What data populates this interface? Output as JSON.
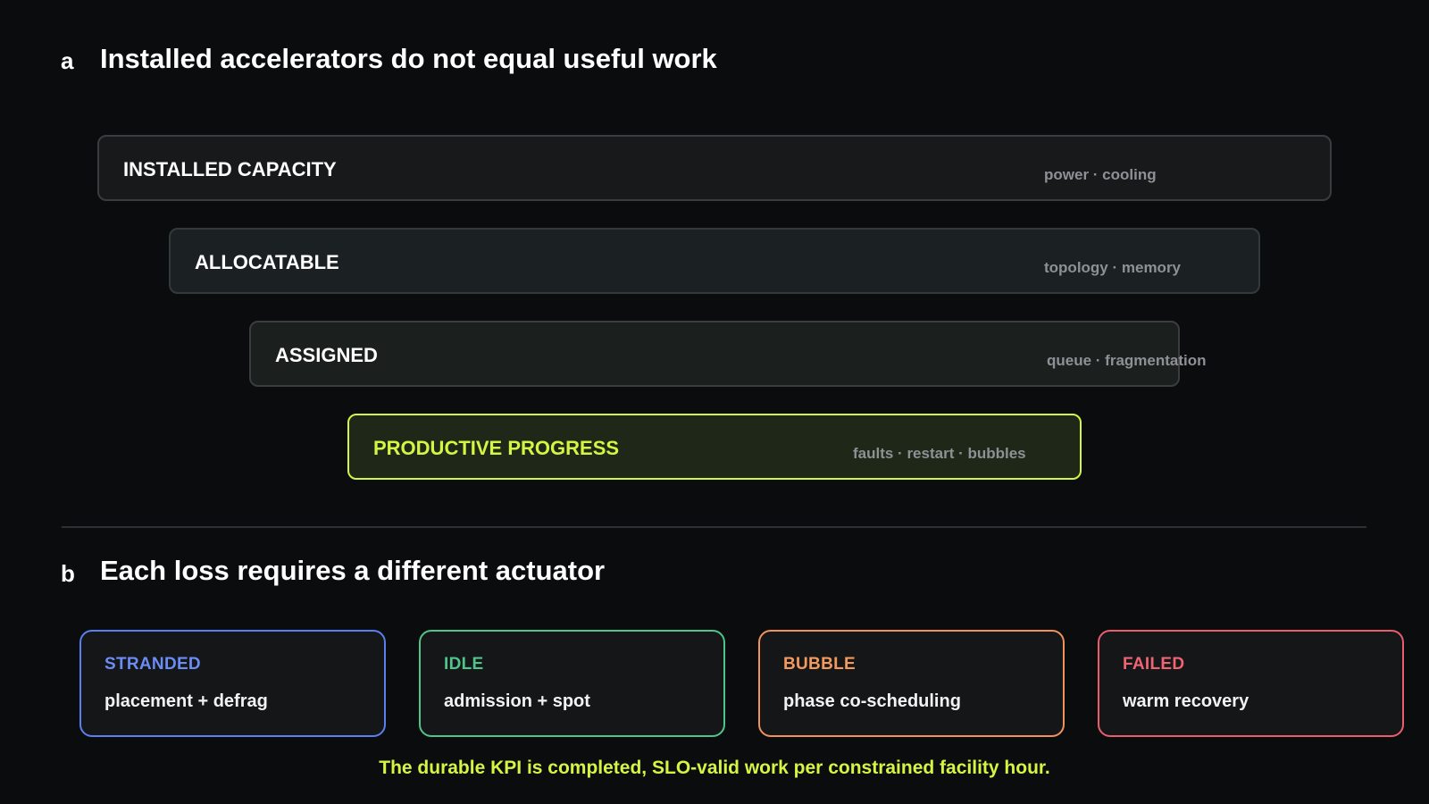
{
  "panel_a": {
    "letter": "a",
    "title": "Installed accelerators do not equal useful work",
    "tiers": [
      {
        "label": "INSTALLED CAPACITY",
        "note": "power · cooling"
      },
      {
        "label": "ALLOCATABLE",
        "note": "topology · memory"
      },
      {
        "label": "ASSIGNED",
        "note": "queue · fragmentation"
      },
      {
        "label": "PRODUCTIVE PROGRESS",
        "note": "faults · restart · bubbles"
      }
    ],
    "highlight_color": "#d4f542"
  },
  "panel_b": {
    "letter": "b",
    "title": "Each loss requires a different actuator",
    "cards": [
      {
        "label": "STRANDED",
        "text": "placement + defrag",
        "color": "#6b8cf5"
      },
      {
        "label": "IDLE",
        "text": "admission + spot",
        "color": "#4fc48b"
      },
      {
        "label": "BUBBLE",
        "text": "phase co-scheduling",
        "color": "#f29a5e"
      },
      {
        "label": "FAILED",
        "text": "warm recovery",
        "color": "#ee6472"
      }
    ],
    "footer": "The durable KPI is completed, SLO-valid work per constrained facility hour."
  }
}
